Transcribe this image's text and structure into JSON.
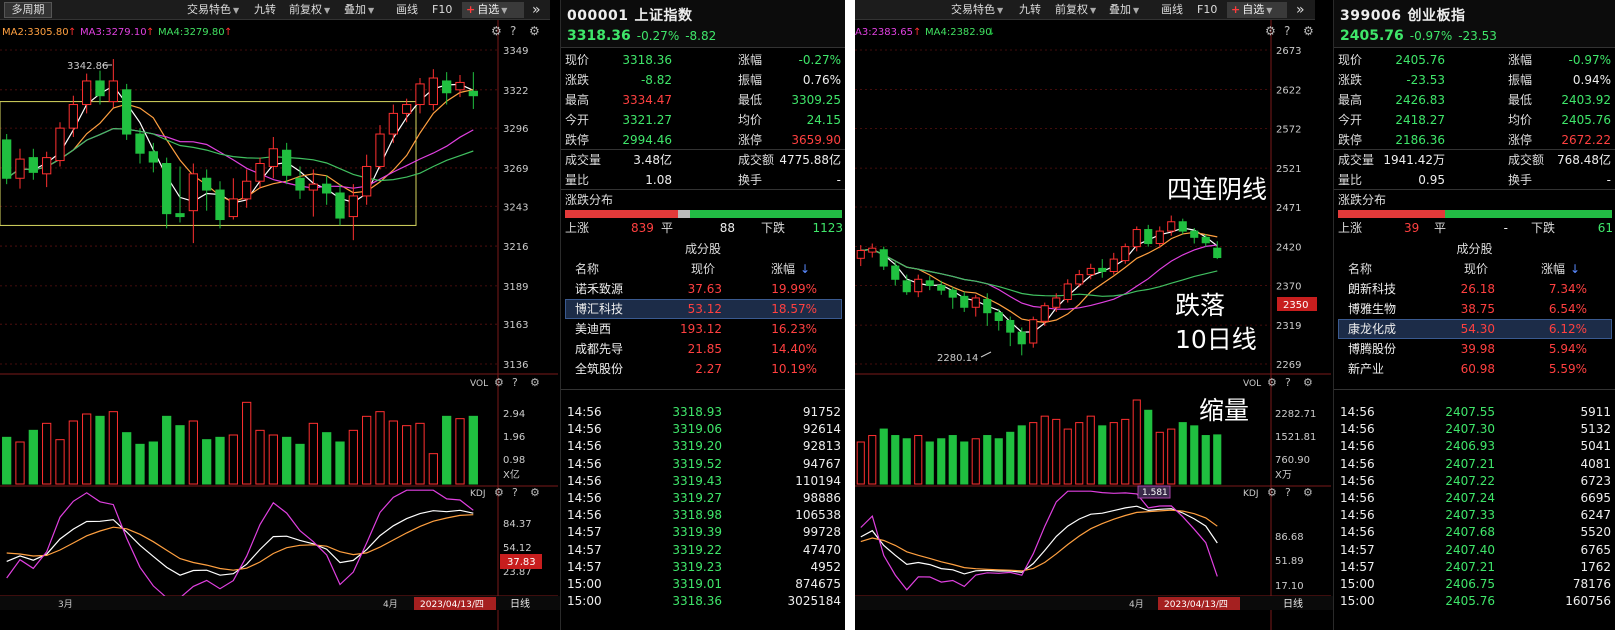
{
  "left": {
    "toolbar": {
      "period": "多周期",
      "features": "交易特色",
      "nine": "九转",
      "fuquan": "前复权",
      "overlay": "叠加",
      "draw": "画线",
      "f10": "F10",
      "fav": "自选",
      "more": "»"
    },
    "ma_legend": [
      {
        "label": "MA2:3305.80",
        "arrow": "↑",
        "color": "#ffa040"
      },
      {
        "label": "MA3:3279.10",
        "arrow": "↑",
        "color": "#e040e0"
      },
      {
        "label": "MA4:3279.80",
        "arrow": "↑",
        "color": "#40e060"
      }
    ],
    "high_label": "3342.86",
    "yticks": [
      "3349",
      "3322",
      "3296",
      "3269",
      "3243",
      "3216",
      "3189",
      "3163",
      "3136"
    ],
    "vol": {
      "title": "VOL",
      "ticks": [
        "2.94",
        "1.96",
        "0.98"
      ],
      "unit": "X亿"
    },
    "kdj": {
      "title": "KDJ",
      "ticks": [
        "84.37",
        "54.12",
        "23.87"
      ],
      "current": "37.83"
    },
    "xaxis": {
      "m1": "3月",
      "m2": "4月",
      "date": "2023/04/13/四",
      "tab": "日线"
    },
    "quote": {
      "code": "000001",
      "name": "上证指数",
      "price": "3318.36",
      "pct": "-0.27%",
      "chg": "-8.82",
      "rows": [
        {
          "l1": "现价",
          "v1": "3318.36",
          "c1": "dn",
          "l2": "涨幅",
          "v2": "-0.27%",
          "c2": "dn"
        },
        {
          "l1": "涨跌",
          "v1": "-8.82",
          "c1": "dn",
          "l2": "振幅",
          "v2": "0.76%",
          "c2": "wht"
        },
        {
          "l1": "最高",
          "v1": "3334.47",
          "c1": "up",
          "l2": "最低",
          "v2": "3309.25",
          "c2": "dn"
        },
        {
          "l1": "今开",
          "v1": "3321.27",
          "c1": "dn",
          "l2": "均价",
          "v2": "24.15",
          "c2": "dn"
        },
        {
          "l1": "跌停",
          "v1": "2994.46",
          "c1": "dn",
          "l2": "涨停",
          "v2": "3659.90",
          "c2": "up"
        },
        {
          "l1": "成交量",
          "v1": "3.48亿",
          "c1": "wht",
          "l2": "成交额",
          "v2": "4775.88亿",
          "c2": "wht"
        },
        {
          "l1": "量比",
          "v1": "1.08",
          "c1": "wht",
          "l2": "换手",
          "v2": "-",
          "c2": "wht"
        }
      ],
      "dist": {
        "title": "涨跌分布",
        "up_label": "上涨",
        "up": "839",
        "flat_label": "平",
        "flat": "88",
        "down_label": "下跌",
        "down": "1123",
        "up_n": 839,
        "flat_n": 88,
        "down_n": 1123
      },
      "cf": {
        "title": "成分股",
        "h_name": "名称",
        "h_price": "现价",
        "h_pct": "涨幅",
        "arrow": "↓",
        "rows": [
          {
            "name": "诺禾致源",
            "price": "37.63",
            "pct": "19.99%"
          },
          {
            "name": "博汇科技",
            "price": "53.12",
            "pct": "18.57%"
          },
          {
            "name": "美迪西",
            "price": "193.12",
            "pct": "16.23%"
          },
          {
            "name": "成都先导",
            "price": "21.85",
            "pct": "14.40%"
          },
          {
            "name": "全筑股份",
            "price": "2.27",
            "pct": "10.19%"
          }
        ]
      },
      "ticks": [
        {
          "t": "14:56",
          "p": "3318.93",
          "v": "91752"
        },
        {
          "t": "14:56",
          "p": "3319.06",
          "v": "92614"
        },
        {
          "t": "14:56",
          "p": "3319.20",
          "v": "92813"
        },
        {
          "t": "14:56",
          "p": "3319.52",
          "v": "94767"
        },
        {
          "t": "14:56",
          "p": "3319.43",
          "v": "110194"
        },
        {
          "t": "14:56",
          "p": "3319.27",
          "v": "98886"
        },
        {
          "t": "14:56",
          "p": "3318.98",
          "v": "106538"
        },
        {
          "t": "14:57",
          "p": "3319.39",
          "v": "99728"
        },
        {
          "t": "14:57",
          "p": "3319.22",
          "v": "47470"
        },
        {
          "t": "14:57",
          "p": "3319.23",
          "v": "4952"
        },
        {
          "t": "15:00",
          "p": "3319.01",
          "v": "874675"
        },
        {
          "t": "15:00",
          "p": "3318.36",
          "v": "3025184"
        }
      ]
    }
  },
  "right": {
    "toolbar": {
      "features": "交易特色",
      "nine": "九转",
      "fuquan": "前复权",
      "overlay": "叠加",
      "draw": "画线",
      "f10": "F10",
      "fav": "自选",
      "more": "»"
    },
    "ma_legend": [
      {
        "label": "A3:2383.65",
        "arrow": "↑",
        "color": "#e040e0"
      },
      {
        "label": "MA4:2382.90",
        "arrow": "↓",
        "color": "#40e060"
      }
    ],
    "low_label": "2280.14",
    "yticks": [
      "2673",
      "2622",
      "2572",
      "2521",
      "2471",
      "2420",
      "2370",
      "2319",
      "2269"
    ],
    "cursor_price": "2350",
    "annotations": {
      "a1": "四连阴线",
      "a2": "跌落",
      "a3": "10日线",
      "a4": "缩量"
    },
    "vol": {
      "title": "VOL",
      "ticks": [
        "2282.71",
        "1521.81",
        "760.90"
      ],
      "unit": "X万",
      "badge": "1.581"
    },
    "kdj": {
      "title": "KDJ",
      "ticks": [
        "86.68",
        "51.89",
        "17.10"
      ]
    },
    "xaxis": {
      "m2": "4月",
      "date": "2023/04/13/四",
      "tab": "日线"
    },
    "quote": {
      "code": "399006",
      "name": "创业板指",
      "price": "2405.76",
      "pct": "-0.97%",
      "chg": "-23.53",
      "rows": [
        {
          "l1": "现价",
          "v1": "2405.76",
          "c1": "dn",
          "l2": "涨幅",
          "v2": "-0.97%",
          "c2": "dn"
        },
        {
          "l1": "涨跌",
          "v1": "-23.53",
          "c1": "dn",
          "l2": "振幅",
          "v2": "0.94%",
          "c2": "wht"
        },
        {
          "l1": "最高",
          "v1": "2426.83",
          "c1": "dn",
          "l2": "最低",
          "v2": "2403.92",
          "c2": "dn"
        },
        {
          "l1": "今开",
          "v1": "2418.27",
          "c1": "dn",
          "l2": "均价",
          "v2": "2405.76",
          "c2": "dn"
        },
        {
          "l1": "跌停",
          "v1": "2186.36",
          "c1": "dn",
          "l2": "涨停",
          "v2": "2672.22",
          "c2": "up"
        },
        {
          "l1": "成交量",
          "v1": "1941.42万",
          "c1": "wht",
          "l2": "成交额",
          "v2": "768.48亿",
          "c2": "wht"
        },
        {
          "l1": "量比",
          "v1": "0.95",
          "c1": "wht",
          "l2": "换手",
          "v2": "-",
          "c2": "wht"
        }
      ],
      "dist": {
        "title": "涨跌分布",
        "up_label": "上涨",
        "up": "39",
        "flat_label": "平",
        "flat": "-",
        "down_label": "下跌",
        "down": "61",
        "up_n": 39,
        "flat_n": 0,
        "down_n": 61
      },
      "cf": {
        "title": "成分股",
        "h_name": "名称",
        "h_price": "现价",
        "h_pct": "涨幅",
        "arrow": "↓",
        "rows": [
          {
            "name": "朗新科技",
            "price": "26.18",
            "pct": "7.34%"
          },
          {
            "name": "博雅生物",
            "price": "38.75",
            "pct": "6.54%"
          },
          {
            "name": "康龙化成",
            "price": "54.30",
            "pct": "6.12%"
          },
          {
            "name": "博腾股份",
            "price": "39.98",
            "pct": "5.94%"
          },
          {
            "name": "新产业",
            "price": "60.98",
            "pct": "5.59%"
          }
        ]
      },
      "ticks": [
        {
          "t": "14:56",
          "p": "2407.55",
          "v": "5911"
        },
        {
          "t": "14:56",
          "p": "2407.30",
          "v": "5132"
        },
        {
          "t": "14:56",
          "p": "2406.93",
          "v": "5041"
        },
        {
          "t": "14:56",
          "p": "2407.21",
          "v": "4081"
        },
        {
          "t": "14:56",
          "p": "2407.22",
          "v": "6723"
        },
        {
          "t": "14:56",
          "p": "2407.24",
          "v": "6695"
        },
        {
          "t": "14:56",
          "p": "2407.33",
          "v": "6247"
        },
        {
          "t": "14:56",
          "p": "2407.68",
          "v": "5520"
        },
        {
          "t": "14:57",
          "p": "2407.40",
          "v": "6765"
        },
        {
          "t": "14:57",
          "p": "2407.21",
          "v": "1762"
        },
        {
          "t": "15:00",
          "p": "2406.75",
          "v": "78176"
        },
        {
          "t": "15:00",
          "p": "2405.76",
          "v": "160756"
        }
      ]
    }
  },
  "chart_data": [
    {
      "type": "candlestick",
      "title": "000001 上证指数 日线",
      "ylim": [
        3136,
        3349
      ],
      "yticks": [
        3349,
        3322,
        3296,
        3269,
        3243,
        3216,
        3189,
        3163,
        3136
      ],
      "candles": [
        [
          3288,
          3262,
          3292,
          3258
        ],
        [
          3262,
          3275,
          3282,
          3255
        ],
        [
          3276,
          3266,
          3282,
          3261
        ],
        [
          3265,
          3276,
          3280,
          3256
        ],
        [
          3274,
          3296,
          3300,
          3270
        ],
        [
          3296,
          3312,
          3318,
          3290
        ],
        [
          3312,
          3328,
          3333,
          3306
        ],
        [
          3328,
          3318,
          3335,
          3312
        ],
        [
          3314,
          3328,
          3342.86,
          3310
        ],
        [
          3322,
          3292,
          3326,
          3288
        ],
        [
          3292,
          3279,
          3296,
          3272
        ],
        [
          3280,
          3273,
          3286,
          3266
        ],
        [
          3272,
          3238,
          3276,
          3228
        ],
        [
          3238,
          3236,
          3270,
          3232
        ],
        [
          3240,
          3265,
          3272,
          3218
        ],
        [
          3262,
          3254,
          3268,
          3240
        ],
        [
          3254,
          3234,
          3260,
          3228
        ],
        [
          3236,
          3248,
          3262,
          3234
        ],
        [
          3248,
          3260,
          3268,
          3242
        ],
        [
          3260,
          3272,
          3276,
          3255
        ],
        [
          3270,
          3282,
          3290,
          3262
        ],
        [
          3281,
          3264,
          3286,
          3258
        ],
        [
          3262,
          3254,
          3270,
          3248
        ],
        [
          3254,
          3258,
          3268,
          3236
        ],
        [
          3258,
          3252,
          3264,
          3244
        ],
        [
          3252,
          3235,
          3258,
          3230
        ],
        [
          3236,
          3250,
          3258,
          3220
        ],
        [
          3250,
          3270,
          3278,
          3244
        ],
        [
          3270,
          3292,
          3298,
          3268
        ],
        [
          3292,
          3306,
          3312,
          3286
        ],
        [
          3306,
          3312,
          3316,
          3300
        ],
        [
          3312,
          3326,
          3330,
          3306
        ],
        [
          3312,
          3330,
          3336,
          3308
        ],
        [
          3328,
          3320,
          3334,
          3312
        ],
        [
          3322,
          3327,
          3332,
          3317
        ],
        [
          3321,
          3318,
          3334,
          3309
        ]
      ],
      "vol": [
        2.0,
        1.8,
        2.3,
        2.6,
        1.9,
        2.7,
        3.0,
        2.9,
        3.1,
        2.2,
        1.7,
        1.8,
        2.9,
        2.5,
        2.7,
        1.9,
        2.0,
        2.1,
        3.5,
        2.3,
        2.1,
        2.0,
        1.7,
        2.6,
        2.2,
        1.8,
        2.3,
        2.9,
        3.1,
        2.7,
        2.5,
        2.6,
        1.3,
        2.9,
        2.8,
        2.9
      ],
      "vol_ylim": [
        0,
        3.6
      ],
      "kdj_ylim": [
        10,
        100
      ]
    },
    {
      "type": "candlestick",
      "title": "399006 创业板指 日线",
      "ylim": [
        2269,
        2673
      ],
      "yticks": [
        2673,
        2622,
        2572,
        2521,
        2471,
        2420,
        2370,
        2319,
        2269
      ],
      "candles": [
        [
          2405,
          2415,
          2422,
          2395
        ],
        [
          2413,
          2418,
          2424,
          2406
        ],
        [
          2416,
          2395,
          2420,
          2390
        ],
        [
          2395,
          2378,
          2400,
          2370
        ],
        [
          2376,
          2362,
          2384,
          2358
        ],
        [
          2362,
          2378,
          2384,
          2355
        ],
        [
          2376,
          2370,
          2382,
          2364
        ],
        [
          2370,
          2364,
          2376,
          2358
        ],
        [
          2364,
          2355,
          2368,
          2340
        ],
        [
          2356,
          2342,
          2362,
          2336
        ],
        [
          2342,
          2354,
          2358,
          2330
        ],
        [
          2352,
          2335,
          2360,
          2318
        ],
        [
          2335,
          2325,
          2340,
          2312
        ],
        [
          2325,
          2310,
          2330,
          2292
        ],
        [
          2310,
          2295,
          2316,
          2280.14
        ],
        [
          2296,
          2326,
          2330,
          2290
        ],
        [
          2324,
          2344,
          2348,
          2318
        ],
        [
          2342,
          2354,
          2360,
          2336
        ],
        [
          2352,
          2372,
          2378,
          2348
        ],
        [
          2372,
          2384,
          2390,
          2368
        ],
        [
          2384,
          2392,
          2398,
          2378
        ],
        [
          2392,
          2388,
          2404,
          2380
        ],
        [
          2388,
          2404,
          2412,
          2384
        ],
        [
          2402,
          2420,
          2424,
          2398
        ],
        [
          2420,
          2442,
          2446,
          2414
        ],
        [
          2442,
          2424,
          2448,
          2420
        ],
        [
          2424,
          2440,
          2446,
          2418
        ],
        [
          2440,
          2452,
          2460,
          2434
        ],
        [
          2452,
          2440,
          2456,
          2436
        ],
        [
          2440,
          2432,
          2444,
          2424
        ],
        [
          2432,
          2425,
          2436,
          2420
        ],
        [
          2418,
          2406,
          2427,
          2404
        ]
      ],
      "vol": [
        1300,
        1500,
        1700,
        1500,
        1400,
        1500,
        1300,
        1400,
        1500,
        1300,
        1400,
        1500,
        1400,
        1600,
        1800,
        1900,
        2100,
        2000,
        1700,
        1900,
        2100,
        1800,
        1900,
        2000,
        2600,
        2282,
        1600,
        1700,
        1900,
        1800,
        1500,
        1520
      ],
      "vol_ylim": [
        0,
        2600
      ],
      "kdj_ylim": [
        0,
        100
      ]
    }
  ]
}
